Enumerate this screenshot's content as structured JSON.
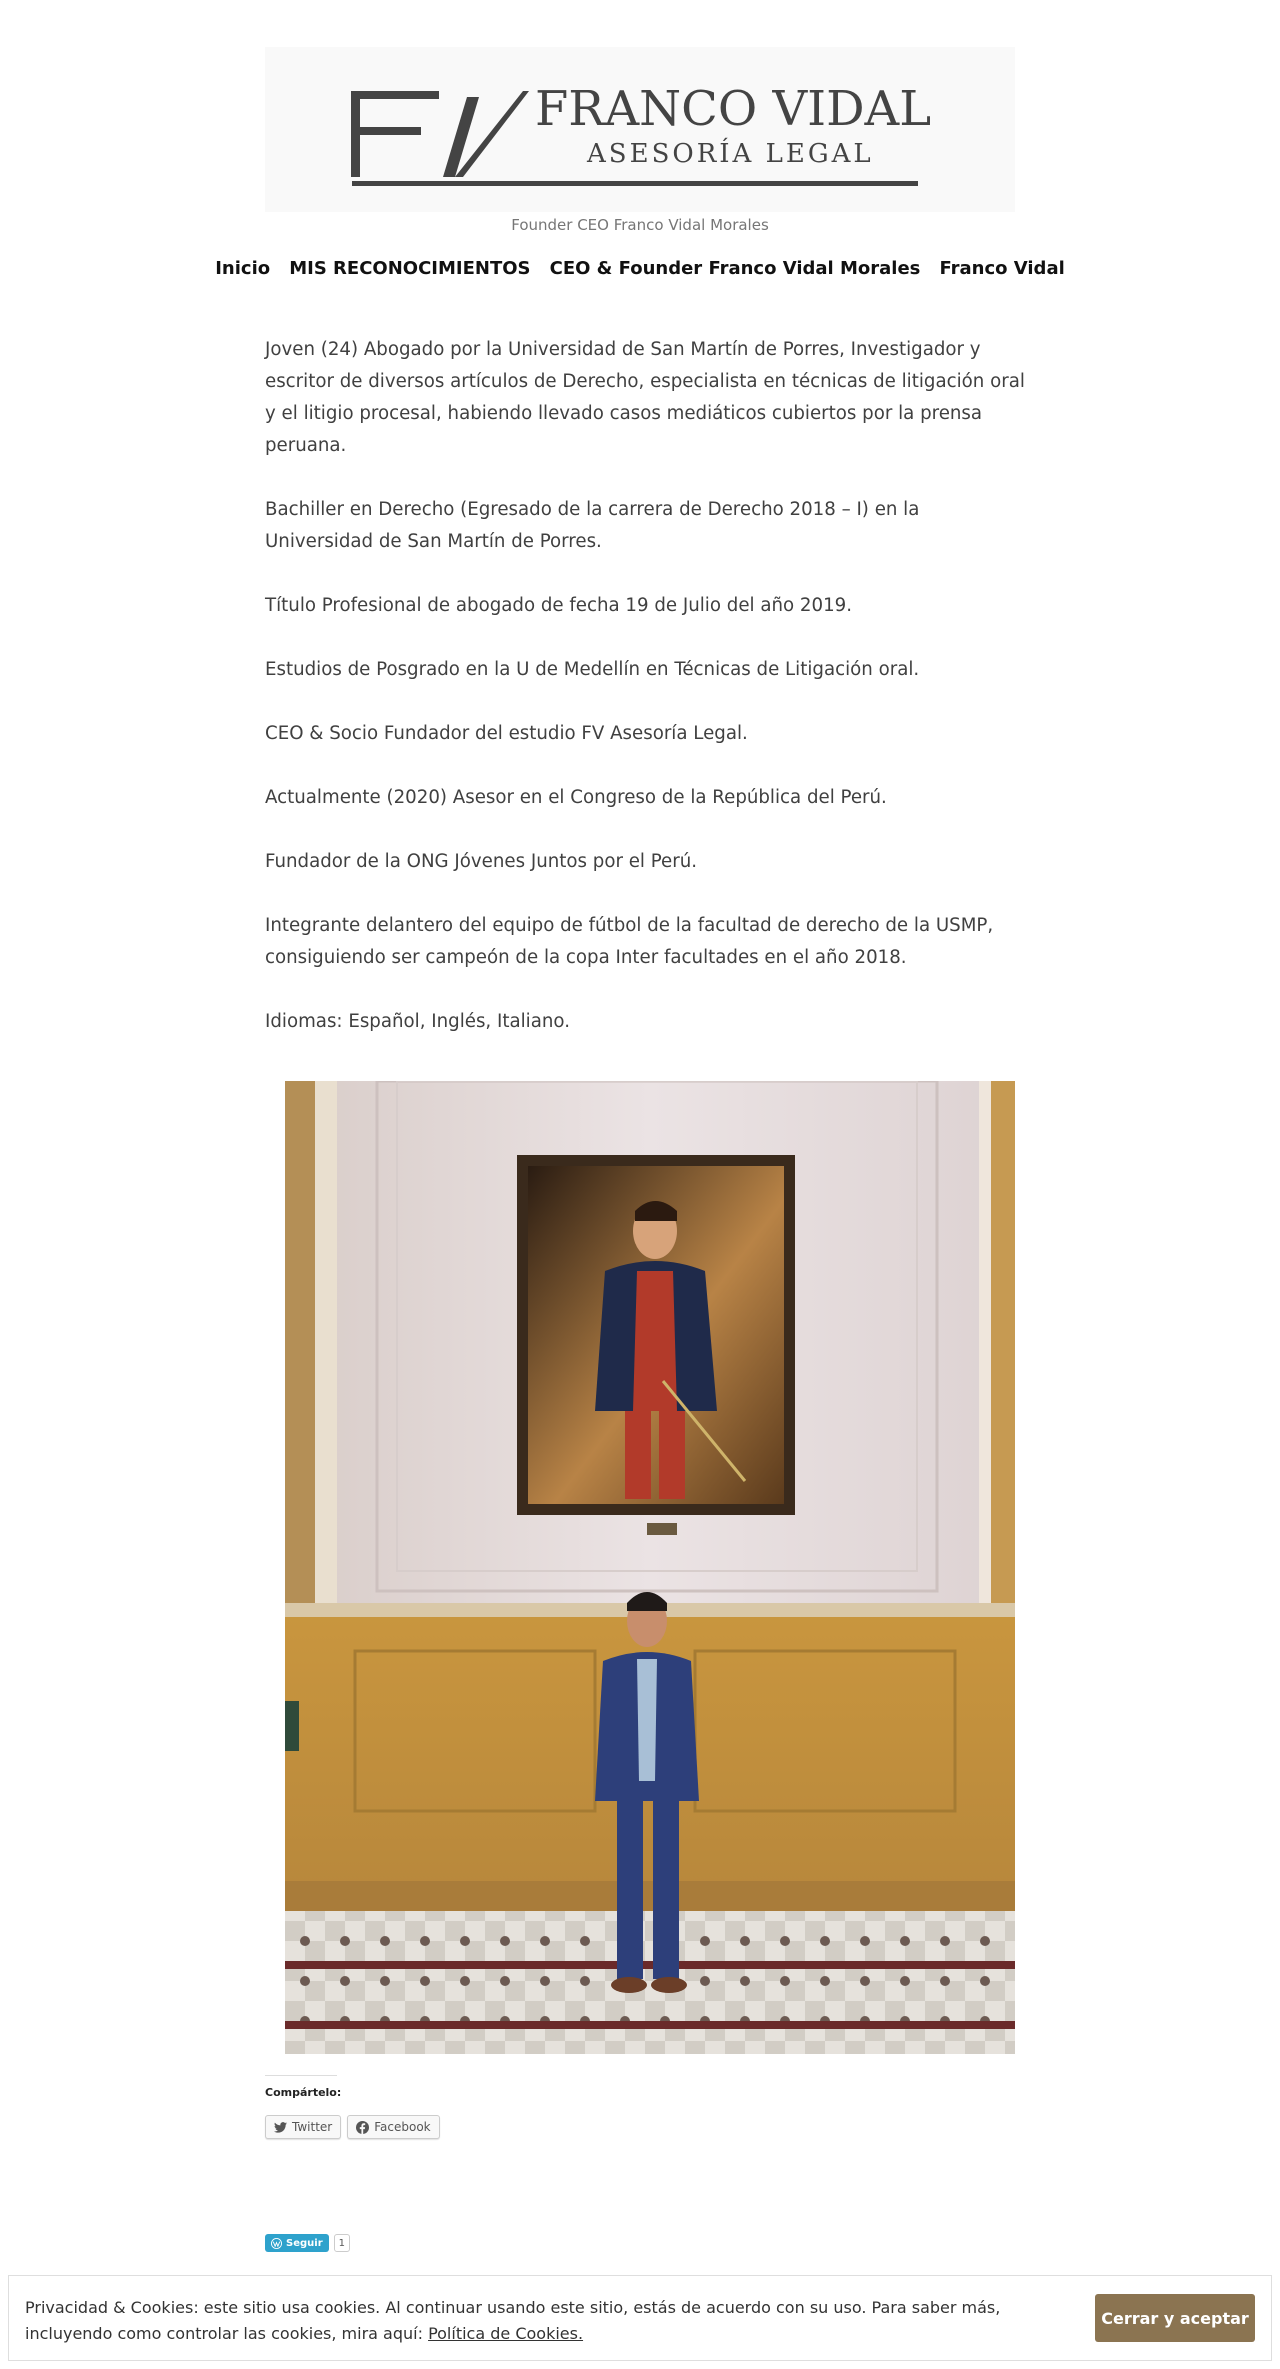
{
  "header": {
    "logo_title": "FRANCO VIDAL",
    "logo_subtitle": "ASESORÍA LEGAL",
    "caption": "Founder CEO Franco Vidal Morales"
  },
  "nav": {
    "items": [
      {
        "label": "Inicio"
      },
      {
        "label": "MIS RECONOCIMIENTOS"
      },
      {
        "label": "CEO & Founder Franco Vidal Morales"
      },
      {
        "label": "Franco Vidal"
      }
    ]
  },
  "content": {
    "paragraphs": [
      "Joven (24) Abogado por la Universidad de San Martín de Porres, Investigador y escritor de diversos artículos de Derecho, especialista en  técnicas de litigación oral y el litigio procesal, habiendo llevado casos mediáticos cubiertos por la prensa peruana.",
      "Bachiller en Derecho (Egresado de la carrera de Derecho 2018 – I)  en la Universidad de San Martín de Porres.",
      "Título Profesional de abogado de fecha 19 de Julio del año 2019.",
      "Estudios de Posgrado en la U de Medellín en Técnicas de Litigación oral.",
      "CEO & Socio Fundador del estudio FV Asesoría Legal.",
      "Actualmente (2020) Asesor en el Congreso de la República del Perú.",
      "Fundador de la ONG Jóvenes Juntos por el Perú.",
      "Integrante delantero del equipo de fútbol de la facultad de derecho de la USMP, consiguiendo ser campeón de la copa Inter facultades en el año 2018.",
      "Idiomas: Español, Inglés, Italiano."
    ]
  },
  "share": {
    "title": "Compártelo:",
    "buttons": [
      {
        "label": "Twitter",
        "icon": "twitter-icon"
      },
      {
        "label": "Facebook",
        "icon": "facebook-icon"
      }
    ]
  },
  "follow": {
    "label": "Seguir",
    "count": "1"
  },
  "cookie": {
    "text": "Privacidad & Cookies: este sitio usa cookies. Al continuar usando este sitio, estás de acuerdo con su uso. Para saber más, incluyendo como controlar las cookies, mira aquí: ",
    "link": "Política de Cookies.",
    "button": "Cerrar y aceptar",
    "button_color": "#8b7451"
  }
}
